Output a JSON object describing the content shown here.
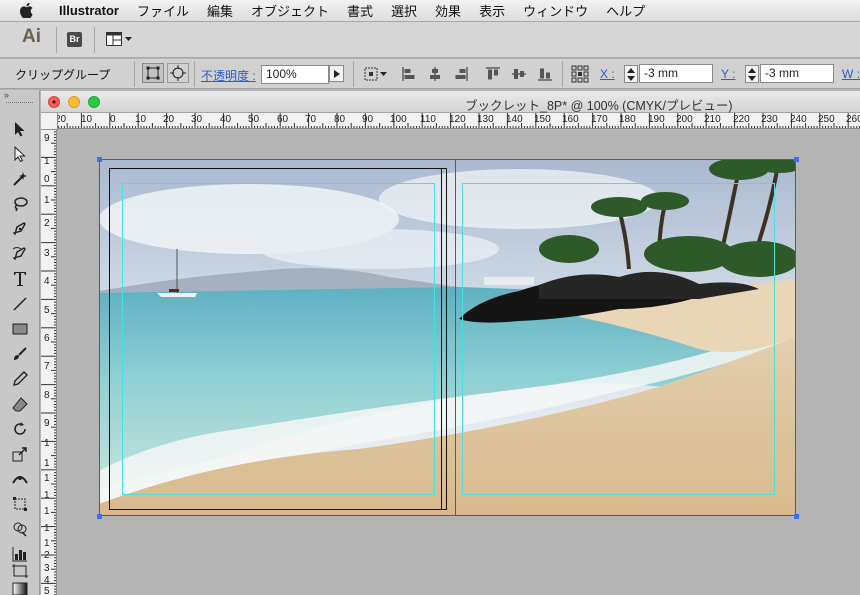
{
  "menubar": {
    "app_name": "Illustrator",
    "items": [
      "ファイル",
      "編集",
      "オブジェクト",
      "書式",
      "選択",
      "効果",
      "表示",
      "ウィンドウ",
      "ヘルプ"
    ]
  },
  "appbar": {
    "ai_logo": "Ai",
    "bridge_logo": "Br"
  },
  "control_bar": {
    "selection_type": "クリップグループ",
    "opacity_label": "不透明度 :",
    "opacity_value": "100%",
    "x_label": "X :",
    "x_value": "-3 mm",
    "y_label": "Y :",
    "y_value": "-3 mm",
    "w_label": "W :"
  },
  "document": {
    "title": "ブックレット_8P* @ 100% (CMYK/プレビュー)"
  },
  "rulers": {
    "horizontal": [
      "20",
      "10",
      "0",
      "10",
      "20",
      "30",
      "40",
      "50",
      "60",
      "70",
      "80",
      "90",
      "100",
      "110",
      "120",
      "130",
      "140",
      "150",
      "160",
      "170",
      "180",
      "190",
      "200",
      "210",
      "220",
      "230",
      "240",
      "250",
      "260"
    ],
    "vertical": [
      "9",
      "1",
      "0",
      "1",
      "2",
      "3",
      "4",
      "5",
      "6",
      "7",
      "8",
      "9",
      "1",
      "1",
      "1",
      "1",
      "1",
      "1",
      "1",
      "2",
      "3",
      "4",
      "5"
    ]
  },
  "colors": {
    "guide": "#3ee3e3",
    "bleed": "#e0202a",
    "selection": "#3a6cff",
    "link_text": "#2a5cd6"
  },
  "tools": [
    "selection-tool",
    "direct-selection-tool",
    "magic-wand-tool",
    "lasso-tool",
    "pen-tool",
    "curvature-tool",
    "type-tool",
    "line-tool",
    "rectangle-tool",
    "paintbrush-tool",
    "pencil-tool",
    "eraser-tool",
    "rotate-tool",
    "scale-tool",
    "width-tool",
    "free-transform-tool",
    "shape-builder-tool",
    "graph-tool",
    "artboard-tool",
    "gradient-tool"
  ]
}
